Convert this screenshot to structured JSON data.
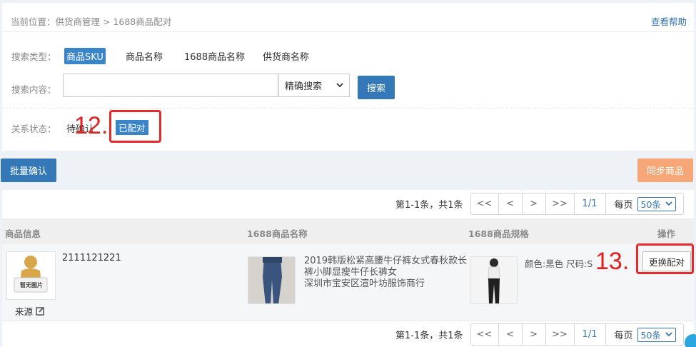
{
  "breadcrumb": {
    "prefix": "当前位置：",
    "path": "供货商管理 > 1688商品配对"
  },
  "help_link": "查看帮助",
  "filters": {
    "search_type_label": "搜索类型：",
    "search_types": [
      "商品SKU",
      "商品名称",
      "1688商品名称",
      "供货商名称"
    ],
    "active_search_type": "商品SKU",
    "search_content_label": "搜索内容：",
    "search_input_value": "",
    "search_mode": "精确搜索",
    "search_button": "搜索",
    "status_label": "关系状态：",
    "status_pending": "待确认",
    "status_matched": "已配对"
  },
  "annotations": {
    "step12": "12.",
    "step13": "13."
  },
  "actions": {
    "batch_confirm": "批量确认",
    "sync_products": "同步商品"
  },
  "pagination": {
    "info": "第1-1条，共1条",
    "first": "<<",
    "prev": "<",
    "next": ">",
    "last": ">>",
    "page": "1/1",
    "per_page_label": "每页",
    "per_page_value": "50条"
  },
  "table": {
    "headers": [
      "商品信息",
      "1688商品名称",
      "1688商品规格",
      "操作"
    ],
    "rows": [
      {
        "sku": "2111121221",
        "image_placeholder": "暂无图片",
        "source_label": "来源",
        "name_1688": "2019韩版松紧高腰牛仔裤女式春秋款长裤小脚显瘦牛仔长裤女",
        "supplier": "深圳市宝安区渲叶坊服饰商行",
        "spec": "颜色:黑色 尺码:S",
        "action": "更换配对"
      }
    ]
  },
  "colors": {
    "primary": "#3478b8",
    "orange": "#f7a777",
    "annotation_red": "#e62a2a"
  }
}
